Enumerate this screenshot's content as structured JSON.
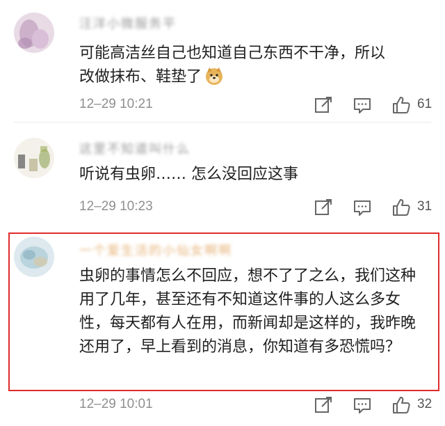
{
  "comments": [
    {
      "username": "汪洋小微服务平",
      "text_line1": "可能高洁丝自己也知道自己东西不干净，所以",
      "text_line2": "改做抹布、鞋垫了",
      "emoji": "doge-emoji-icon",
      "time": "12–29 10:21",
      "likes": "61"
    },
    {
      "username": "这里不知道叫什么",
      "text_line1": "听说有虫卵…… 怎么没回应这事",
      "time": "12–29 10:23",
      "likes": "31"
    },
    {
      "username": "一个爱生活的小仙女啊啊",
      "text": "虫卵的事情怎么不回应，想不了了之么，我们这种用了几年，甚至还有不知道这件事的人这么多女性，每天都有人在用，而新闻却是这样的，我昨晚还用了，早上看到的消息，你知道有多恐慌吗？",
      "time": "12–29 10:01",
      "likes": "32"
    }
  ],
  "icons": {
    "repost": "repost-icon",
    "comment": "comment-icon",
    "like": "thumbs-up-icon"
  },
  "colors": {
    "highlight_border": "#e02b2b",
    "meta_text": "#8f8f8f"
  }
}
